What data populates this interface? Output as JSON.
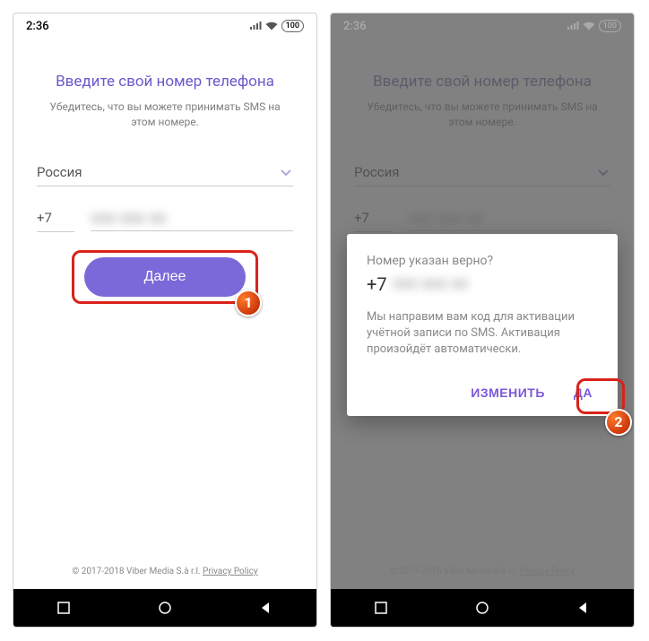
{
  "statusbar": {
    "time": "2:36",
    "battery": "100"
  },
  "screen": {
    "title": "Введите свой номер телефона",
    "subtitle": "Убедитесь, что вы можете принимать SMS на этом номере.",
    "country": "Россия",
    "prefix": "+7",
    "phone_masked": "988 888 88",
    "next_label": "Далее"
  },
  "dialog": {
    "question": "Номер указан верно?",
    "prefix": "+7",
    "phone_masked": "988 888 88",
    "message": "Мы направим вам код для активации учётной записи по SMS. Активация произойдёт автоматически.",
    "edit_label": "ИЗМЕНИТЬ",
    "yes_label": "ДА"
  },
  "footer": {
    "copyright": "© 2017-2018 Viber Media S.à r.l.",
    "privacy": "Privacy Policy"
  },
  "annotations": {
    "step1": "1",
    "step2": "2"
  }
}
